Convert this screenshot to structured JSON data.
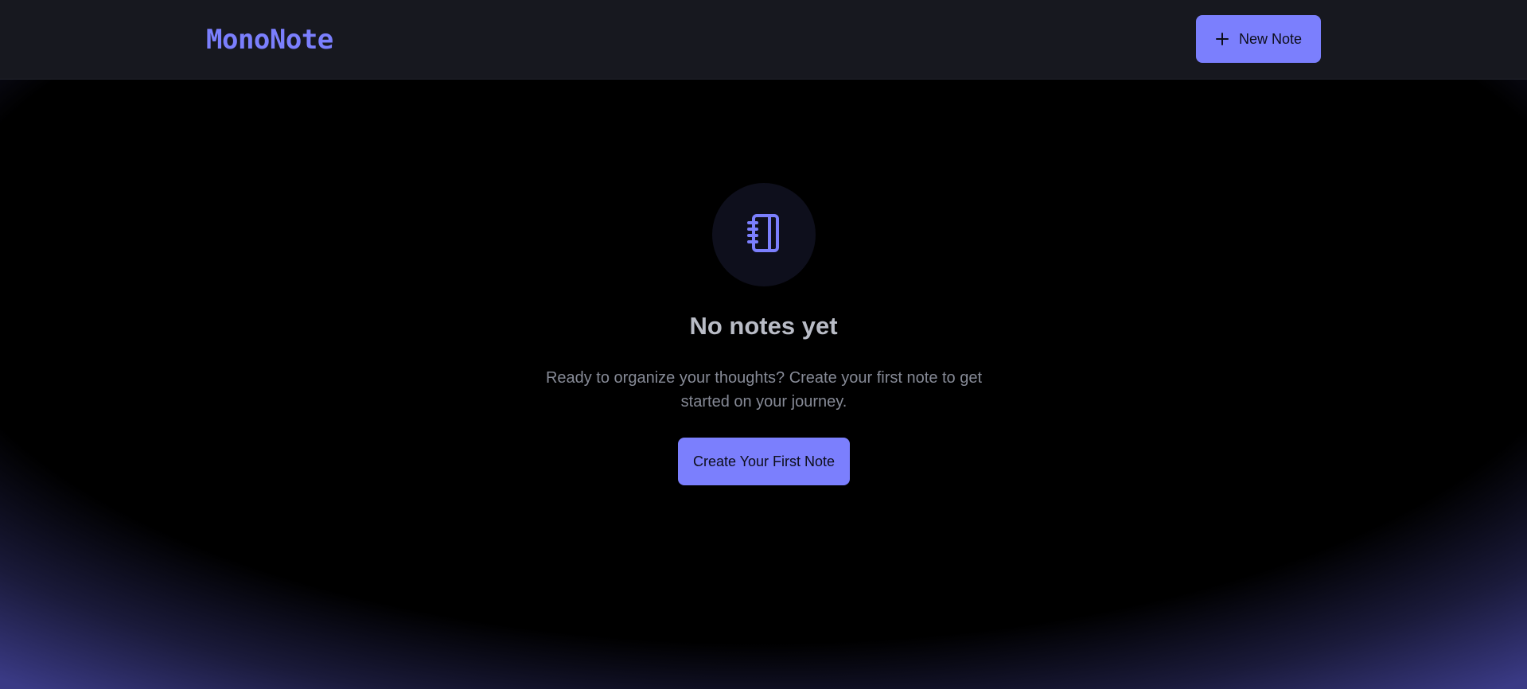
{
  "app": {
    "logo": "MonoNote"
  },
  "header": {
    "new_note_label": "New Note",
    "new_note_icon": "plus-icon"
  },
  "empty_state": {
    "icon": "notebook-icon",
    "title": "No notes yet",
    "description": "Ready to organize your thoughts? Create your first note to get started on your journey.",
    "cta_label": "Create Your First Note"
  },
  "colors": {
    "accent": "#7b7ffd",
    "header_bg": "#17181f",
    "page_bg": "#000000",
    "glow": "#3a3a85"
  }
}
